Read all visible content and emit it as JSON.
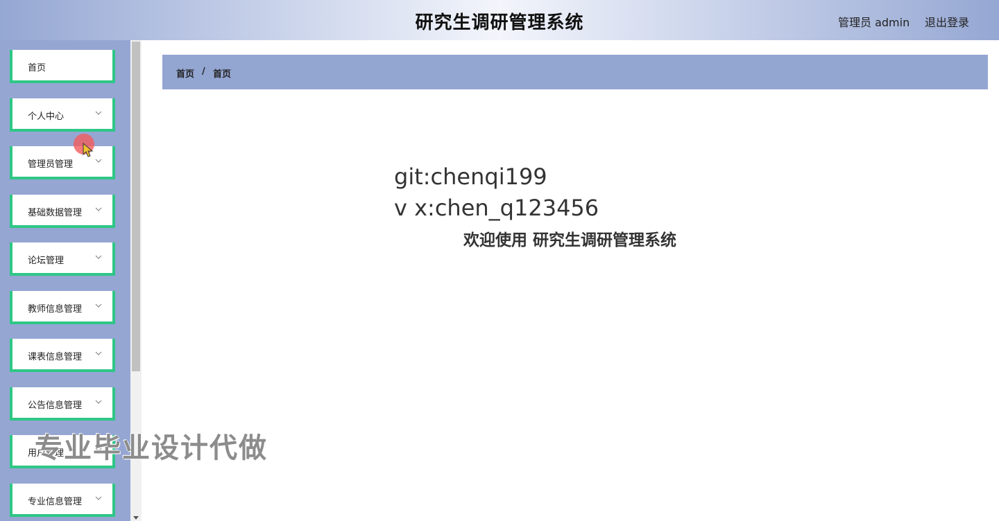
{
  "header": {
    "title": "研究生调研管理系统",
    "user": "管理员 admin",
    "logout": "退出登录"
  },
  "sidebar": {
    "items": [
      {
        "label": "首页",
        "expandable": false
      },
      {
        "label": "个人中心",
        "expandable": true
      },
      {
        "label": "管理员管理",
        "expandable": true
      },
      {
        "label": "基础数据管理",
        "expandable": true
      },
      {
        "label": "论坛管理",
        "expandable": true
      },
      {
        "label": "教师信息管理",
        "expandable": true
      },
      {
        "label": "课表信息管理",
        "expandable": true
      },
      {
        "label": "公告信息管理",
        "expandable": true
      },
      {
        "label": "用户管理",
        "expandable": true
      },
      {
        "label": "专业信息管理",
        "expandable": true
      }
    ]
  },
  "breadcrumb": {
    "items": [
      "首页",
      "首页"
    ],
    "separator": "/"
  },
  "main": {
    "line1": "git:chenqi199",
    "line2": "v x:chen_q123456",
    "welcome": "欢迎使用 研究生调研管理系统"
  },
  "overlay": {
    "watermark": "专业毕业设计代做"
  },
  "colors": {
    "accent_green": "#2ec786",
    "sidebar_bg": "#95a6d3",
    "breadcrumb_bg": "#93a5d1"
  }
}
